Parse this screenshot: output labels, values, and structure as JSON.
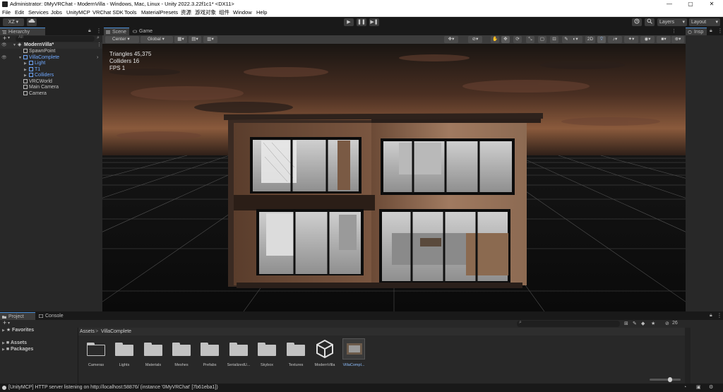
{
  "window": {
    "title": "Administrator: 0MyVRChat - ModernVilla - Windows, Mac, Linux - Unity 2022.3.22f1c1* <DX11>",
    "minimize": "—",
    "maximize": "▢",
    "close": "✕"
  },
  "menu": [
    "File",
    "Edit",
    "Services",
    "Jobs",
    "UnityMCP",
    "VRChat SDK",
    "Tools",
    "MaterialPresets",
    "资源",
    "游戏对象",
    "组件",
    "Window",
    "Help"
  ],
  "toolbar": {
    "account_label": "XZ ▾",
    "cloud_icon": "cloud-icon",
    "play_icon": "▶",
    "pause_icon": "❚❚",
    "step_icon": "▶❚",
    "layers_label": "Layers",
    "layout_label": "Layout"
  },
  "hierarchy": {
    "tab_label": "Hierarchy",
    "search_placeholder": "All",
    "scene_name": "ModernVilla*",
    "items": [
      {
        "label": "SpawnPoint",
        "depth": 1,
        "highlight": false
      },
      {
        "label": "VillaComplete",
        "depth": 1,
        "highlight": true
      },
      {
        "label": "Light",
        "depth": 2,
        "highlight": true
      },
      {
        "label": "T1",
        "depth": 2,
        "highlight": true
      },
      {
        "label": "Colliders",
        "depth": 2,
        "highlight": true
      },
      {
        "label": "VRCWorld",
        "depth": 1,
        "highlight": false
      },
      {
        "label": "Main Camera",
        "depth": 1,
        "highlight": false
      },
      {
        "label": "Camera",
        "depth": 1,
        "highlight": false
      }
    ]
  },
  "scene": {
    "tab_scene": "Scene",
    "tab_game": "Game",
    "pivot_label": "Center",
    "space_label": "Global",
    "mode_2d": "2D",
    "stats": {
      "triangles": "Triangles 45,375",
      "colliders": "Colliders 16",
      "fps": "FPS 1"
    }
  },
  "inspector": {
    "tab_label": "Insp"
  },
  "project": {
    "tab_project": "Project",
    "tab_console": "Console",
    "favorites": "Favorites",
    "assets": "Assets",
    "packages": "Packages",
    "breadcrumb_root": "Assets",
    "breadcrumb_sep": ">",
    "breadcrumb_current": "VillaComplete",
    "hidden_count": "26",
    "items": [
      {
        "label": "Cameras",
        "kind": "folder"
      },
      {
        "label": "Lights",
        "kind": "folder"
      },
      {
        "label": "Materials",
        "kind": "folder"
      },
      {
        "label": "Meshes",
        "kind": "folder"
      },
      {
        "label": "Prefabs",
        "kind": "folder"
      },
      {
        "label": "SerializedU...",
        "kind": "folder"
      },
      {
        "label": "Skybox",
        "kind": "folder"
      },
      {
        "label": "Textures",
        "kind": "folder"
      },
      {
        "label": "ModernVilla",
        "kind": "unity-scene"
      },
      {
        "label": "VillaCompl...",
        "kind": "prefab"
      }
    ]
  },
  "status": {
    "message": "[UnityMCP] HTTP server listening on http://localhost:58876/  (instance '0MyVRChat' [7b61eba1])"
  },
  "colors": {
    "accent": "#4a8fd8",
    "panel": "#282828",
    "toolbar": "#191919",
    "highlight_text": "#6fa8ff"
  }
}
